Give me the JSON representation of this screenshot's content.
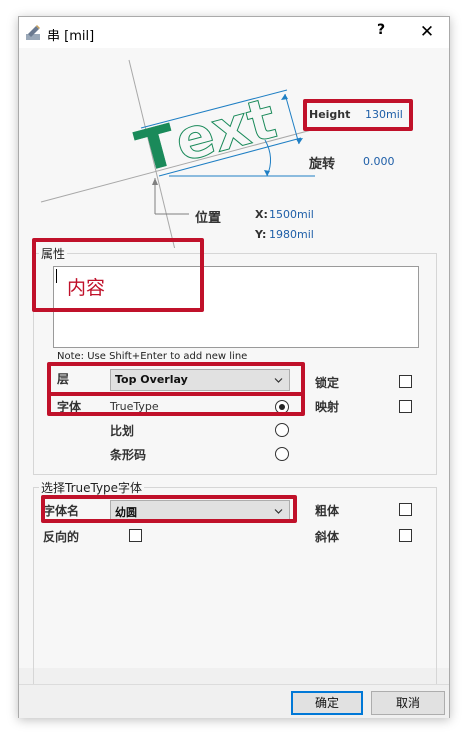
{
  "window": {
    "title": "串 [mil]",
    "help": "?",
    "close": "✕"
  },
  "preview": {
    "sample_text": "Text",
    "height_label": "Height",
    "height_value": "130mil",
    "rotation_label": "旋转",
    "rotation_value": "0.000",
    "position_label": "位置",
    "x_label": "X:",
    "x_value": "1500mil",
    "y_label": "Y:",
    "y_value": "1980mil"
  },
  "properties": {
    "group_title": "属性",
    "content_value": "内容",
    "note": "Note: Use Shift+Enter to add new line",
    "layer_label": "层",
    "layer_value": "Top Overlay",
    "font_label": "字体",
    "font_truetype": "TrueType",
    "font_stroke": "比划",
    "font_barcode": "条形码",
    "lock_label": "锁定",
    "mirror_label": "映射"
  },
  "truetype": {
    "group_title": "选择TrueType字体",
    "font_name_label": "字体名",
    "font_name_value": "幼圆",
    "inverted_label": "反向的",
    "bold_label": "粗体",
    "italic_label": "斜体"
  },
  "buttons": {
    "ok": "确定",
    "cancel": "取消"
  },
  "colors": {
    "highlight_red": "#c0112a",
    "text_green": "#1a8a5a",
    "dimension_blue": "#1f7fc4",
    "value_blue": "#1f5fa8"
  }
}
